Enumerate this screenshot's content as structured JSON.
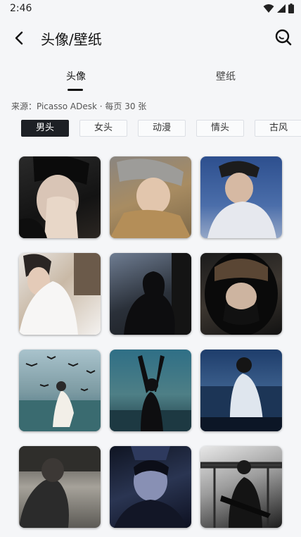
{
  "status": {
    "time": "2:46"
  },
  "header": {
    "title": "头像/壁纸"
  },
  "tabs": [
    {
      "label": "头像",
      "active": true
    },
    {
      "label": "壁纸",
      "active": false
    }
  ],
  "source_text": "来源：Picasso ADesk · 每页 30 张",
  "chips": [
    {
      "label": "男头",
      "active": true
    },
    {
      "label": "女头",
      "active": false
    },
    {
      "label": "动漫",
      "active": false
    },
    {
      "label": "情头",
      "active": false
    },
    {
      "label": "古风",
      "active": false
    }
  ],
  "colors": {
    "accent": "#1d2025",
    "background": "#f5f6f8"
  },
  "thumbnails": [
    {
      "subject": "boy-covering-face-hat"
    },
    {
      "subject": "boy-grey-cap-jacket"
    },
    {
      "subject": "boy-cap-blue-sky"
    },
    {
      "subject": "boy-white-hoodie"
    },
    {
      "subject": "silhouette-window"
    },
    {
      "subject": "boy-helmet"
    },
    {
      "subject": "birds-sea-figure"
    },
    {
      "subject": "arms-raised-sea"
    },
    {
      "subject": "boy-back-sea"
    },
    {
      "subject": "boy-lake-dusk"
    },
    {
      "subject": "boy-night-neon"
    },
    {
      "subject": "guitarist-stage-bw"
    }
  ]
}
